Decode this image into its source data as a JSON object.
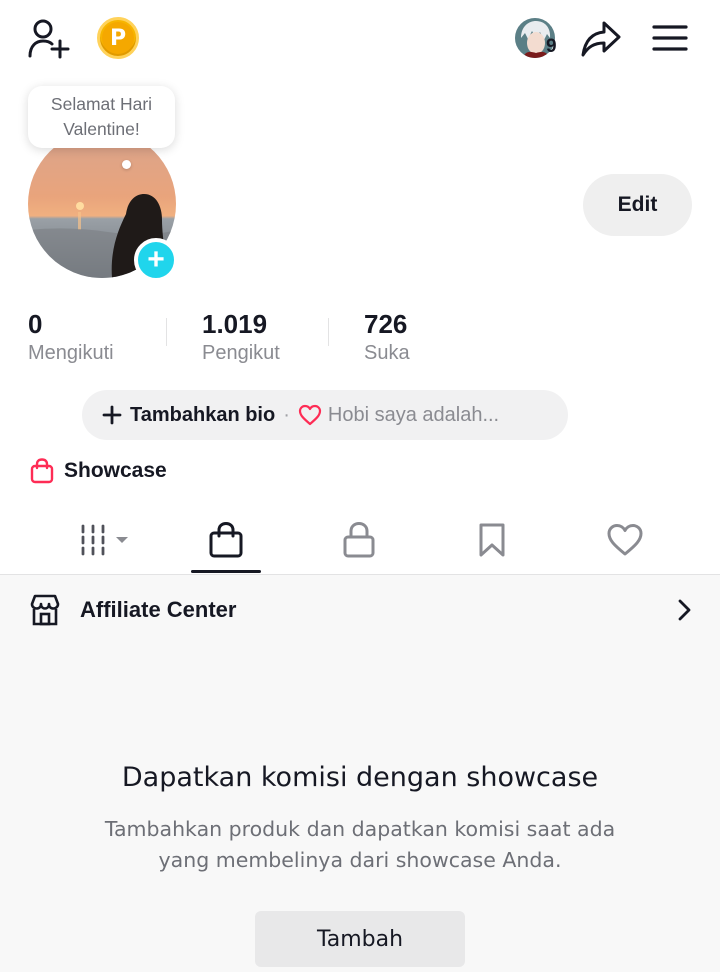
{
  "header": {
    "add_friend_icon": "person-plus-icon",
    "coin_icon": "coin-icon",
    "coin_letter": "P",
    "notification_count": "9",
    "share_icon": "share-arrow-icon",
    "menu_icon": "hamburger-menu-icon"
  },
  "profile": {
    "bubble_text_line1": "Selamat Hari",
    "bubble_text_line2": "Valentine!",
    "plus_badge": "+",
    "edit_label": "Edit"
  },
  "stats": [
    {
      "value": "0",
      "label": "Mengikuti"
    },
    {
      "value": "1.019",
      "label": "Pengikut"
    },
    {
      "value": "726",
      "label": "Suka"
    }
  ],
  "bio": {
    "add_label": "Tambahkan bio",
    "separator": "·",
    "hint": "Hobi saya adalah..."
  },
  "showcase": {
    "label": "Showcase",
    "accent": "#fe2c55"
  },
  "tabs": [
    {
      "icon": "grid-icon",
      "active": false
    },
    {
      "icon": "shopping-bag-icon",
      "active": true
    },
    {
      "icon": "lock-icon",
      "active": false
    },
    {
      "icon": "bookmark-icon",
      "active": false
    },
    {
      "icon": "heart-icon",
      "active": false
    }
  ],
  "affiliate": {
    "label": "Affiliate Center",
    "chevron": "chevron-right-icon"
  },
  "empty_state": {
    "title": "Dapatkan komisi dengan showcase",
    "description_line1": "Tambahkan produk dan dapatkan komisi saat ada",
    "description_line2": "yang membelinya dari showcase Anda.",
    "button_label": "Tambah"
  },
  "colors": {
    "accent_cyan": "#20d5ec",
    "coin_gold": "#f7b500",
    "text_primary": "#161823",
    "text_secondary": "#8a8b91"
  }
}
